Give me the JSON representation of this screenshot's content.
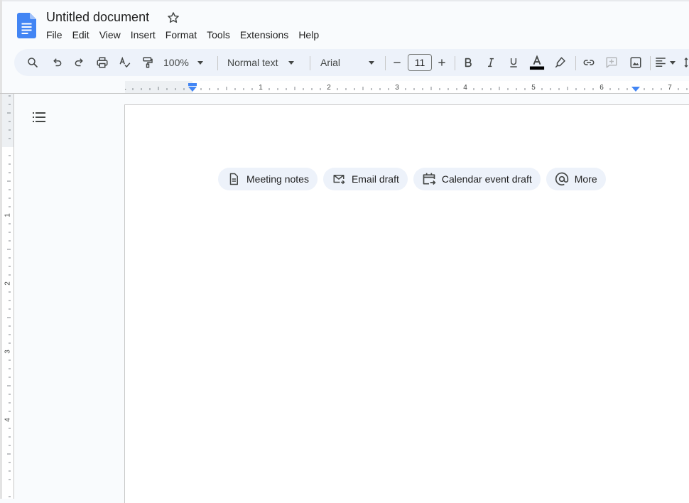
{
  "document": {
    "title": "Untitled document"
  },
  "menu": [
    "File",
    "Edit",
    "View",
    "Insert",
    "Format",
    "Tools",
    "Extensions",
    "Help"
  ],
  "toolbar": {
    "zoom": "100%",
    "paragraph_style": "Normal text",
    "font": "Arial",
    "font_size": "11"
  },
  "ruler": {
    "horizontal_labels": [
      "1",
      "1",
      "2",
      "3",
      "4",
      "5",
      "6",
      "7"
    ],
    "vertical_labels": [
      "1",
      "1",
      "2",
      "3",
      "4"
    ]
  },
  "chips": [
    {
      "label": "Meeting notes",
      "icon": "document-icon"
    },
    {
      "label": "Email draft",
      "icon": "email-icon"
    },
    {
      "label": "Calendar event draft",
      "icon": "calendar-icon"
    },
    {
      "label": "More",
      "icon": "at-sign-icon"
    }
  ],
  "colors": {
    "brand_blue": "#4285f4",
    "toolbar_bg": "#edf2fa",
    "ruler_marker": "#4285f4"
  }
}
